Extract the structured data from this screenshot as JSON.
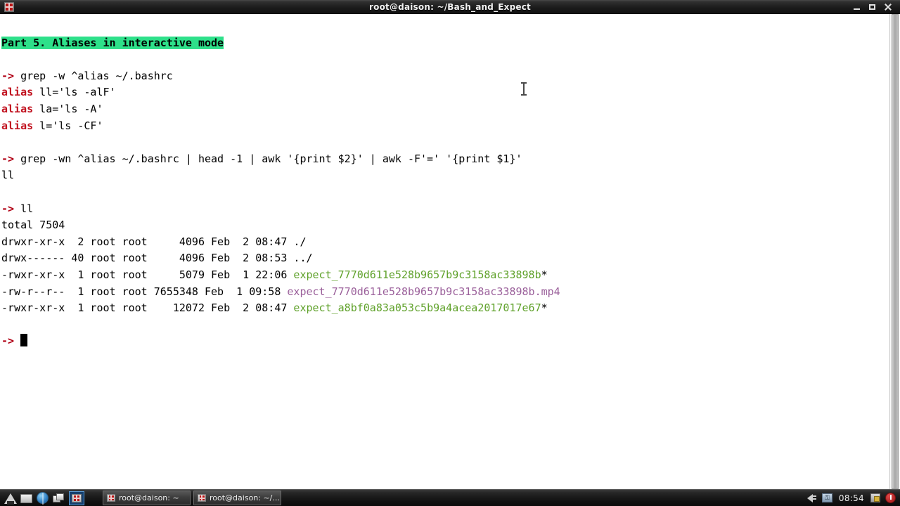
{
  "window": {
    "title": "root@daison: ~/Bash_and_Expect",
    "app_icon": "terminal-icon",
    "minimize_label": "Minimize",
    "maximize_label": "Maximize",
    "close_label": "Close"
  },
  "terminal": {
    "prompt": "->",
    "header": "Part 5. Aliases in interactive mode",
    "colors": {
      "background": "#ffffff",
      "foreground": "#000000",
      "prompt_red": "#b00014",
      "match_red": "#c1121f",
      "highlight_green": "#2ee08a",
      "executable_green": "#5fa12a",
      "media_magenta": "#9a5f9a"
    },
    "lines": [
      {
        "type": "blank"
      },
      {
        "type": "header",
        "text": "Part 5. Aliases in interactive mode"
      },
      {
        "type": "blank"
      },
      {
        "type": "command",
        "prompt": "->",
        "text": " grep -w ^alias ~/.bashrc"
      },
      {
        "type": "grep",
        "match": "alias",
        "rest": " ll='ls -alF'"
      },
      {
        "type": "grep",
        "match": "alias",
        "rest": " la='ls -A'"
      },
      {
        "type": "grep",
        "match": "alias",
        "rest": " l='ls -CF'"
      },
      {
        "type": "blank"
      },
      {
        "type": "command",
        "prompt": "->",
        "text": " grep -wn ^alias ~/.bashrc | head -1 | awk '{print $2}' | awk -F'=' '{print $1}'"
      },
      {
        "type": "output",
        "text": "ll"
      },
      {
        "type": "blank"
      },
      {
        "type": "command",
        "prompt": "->",
        "text": " ll"
      },
      {
        "type": "output",
        "text": "total 7504"
      },
      {
        "type": "listing",
        "meta": "drwxr-xr-x  2 root root     4096 Feb  2 08:47 ",
        "name": "./",
        "color": "plain"
      },
      {
        "type": "listing",
        "meta": "drwx------ 40 root root     4096 Feb  2 08:53 ",
        "name": "../",
        "color": "plain"
      },
      {
        "type": "listing",
        "meta": "-rwxr-xr-x  1 root root     5079 Feb  1 22:06 ",
        "name": "expect_7770d611e528b9657b9c3158ac33898b",
        "suffix": "*",
        "color": "green"
      },
      {
        "type": "listing",
        "meta": "-rw-r--r--  1 root root 7655348 Feb  1 09:58 ",
        "name": "expect_7770d611e528b9657b9c3158ac33898b.mp4",
        "suffix": "",
        "color": "magenta"
      },
      {
        "type": "listing",
        "meta": "-rwxr-xr-x  1 root root    12072 Feb  2 08:47 ",
        "name": "expect_a8bf0a83a053c5b9a4acea2017017e67",
        "suffix": "*",
        "color": "green"
      },
      {
        "type": "blank"
      },
      {
        "type": "cursorline",
        "prompt": "->",
        "text": " "
      }
    ]
  },
  "scrollbar": {
    "name": "terminal-scrollbar"
  },
  "taskbar": {
    "launchers": [
      {
        "name": "arch-menu-icon",
        "label": "Arch menu"
      },
      {
        "name": "terminal-launcher-icon",
        "label": "Terminal"
      },
      {
        "name": "browser-launcher-icon",
        "label": "Web browser"
      },
      {
        "name": "show-desktop-icon",
        "label": "Show desktop"
      }
    ],
    "selected_launcher": {
      "name": "terminal-window-icon",
      "label": "Terminal"
    },
    "tasks": [
      {
        "label": "root@daison: ~",
        "active": false
      },
      {
        "label": "root@daison: ~/...",
        "active": true
      }
    ],
    "tray": [
      {
        "name": "speaker-icon",
        "label": "Volume"
      },
      {
        "name": "key-icon",
        "label": "Keyring"
      }
    ],
    "clock": "08:54",
    "tray_right": [
      {
        "name": "display-lock-icon",
        "label": "Lock screen"
      },
      {
        "name": "power-icon",
        "label": "Power"
      }
    ]
  }
}
